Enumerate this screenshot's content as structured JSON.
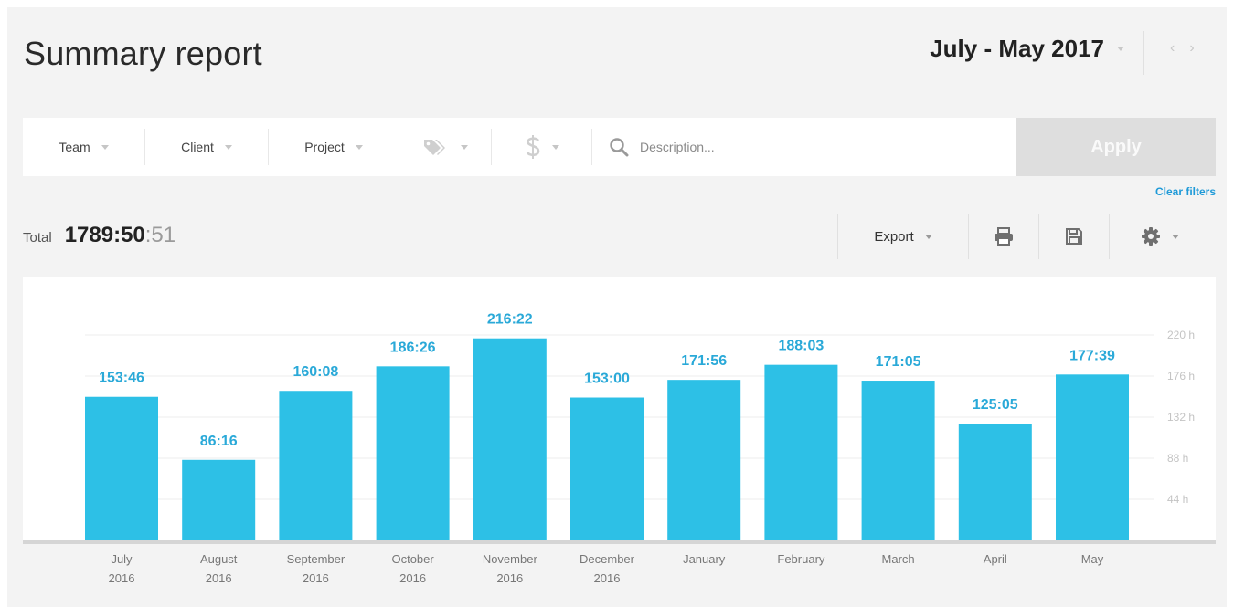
{
  "header": {
    "title": "Summary report",
    "period": "July - May 2017",
    "prev_arrow": "‹",
    "next_arrow": "›"
  },
  "filters": {
    "team": "Team",
    "client": "Client",
    "project": "Project",
    "tags_icon": "tag-icon",
    "billable_icon": "dollar-icon",
    "search_icon": "search-icon",
    "search_placeholder": "Description...",
    "apply": "Apply",
    "clear": "Clear filters"
  },
  "summary": {
    "total_label": "Total",
    "total_value": "1789:50",
    "total_seconds": ":51"
  },
  "toolbar": {
    "export": "Export",
    "print_icon": "print-icon",
    "save_icon": "save-icon",
    "settings_icon": "gear-icon"
  },
  "colors": {
    "bar": "#2dc0e6",
    "bar_label": "#2aa9d8",
    "accent_link": "#1f9ad8",
    "apply_disabled": "#dedede"
  },
  "chart_data": {
    "type": "bar",
    "categories": [
      "July 2016",
      "August 2016",
      "September 2016",
      "October 2016",
      "November 2016",
      "December 2016",
      "January",
      "February",
      "March",
      "April",
      "May"
    ],
    "category_lines": [
      [
        "July",
        "2016"
      ],
      [
        "August",
        "2016"
      ],
      [
        "September",
        "2016"
      ],
      [
        "October",
        "2016"
      ],
      [
        "November",
        "2016"
      ],
      [
        "December",
        "2016"
      ],
      [
        "January"
      ],
      [
        "February"
      ],
      [
        "March"
      ],
      [
        "April"
      ],
      [
        "May"
      ]
    ],
    "values": [
      153.77,
      86.27,
      160.13,
      186.43,
      216.37,
      153.0,
      171.93,
      188.05,
      171.08,
      125.08,
      177.65
    ],
    "value_labels": [
      "153:46",
      "86:16",
      "160:08",
      "186:26",
      "216:22",
      "153:00",
      "171:56",
      "188:03",
      "171:05",
      "125:05",
      "177:39"
    ],
    "y_ticks": [
      44,
      88,
      132,
      176,
      220
    ],
    "y_tick_labels": [
      "44 h",
      "88 h",
      "132 h",
      "176 h",
      "220 h"
    ],
    "ylim": [
      0,
      220
    ],
    "grid": true,
    "y_axis_side": "right"
  }
}
